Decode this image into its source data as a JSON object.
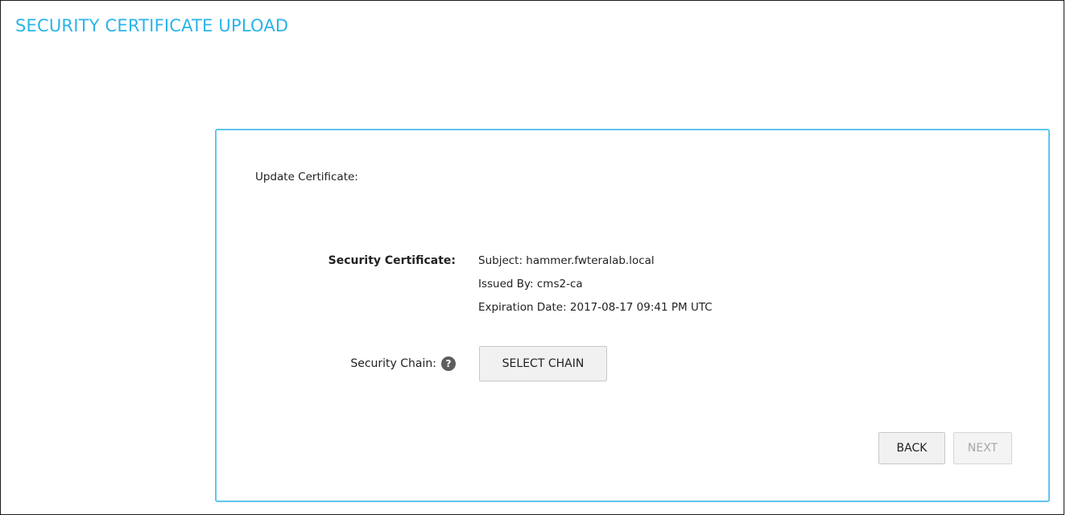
{
  "page": {
    "title": "SECURITY CERTIFICATE UPLOAD"
  },
  "panel": {
    "heading": "Update Certificate:",
    "certificate_label": "Security Certificate:",
    "certificate": {
      "subject": "Subject: hammer.fwteralab.local",
      "issued_by": "Issued By: cms2-ca",
      "expiration": "Expiration Date: 2017-08-17 09:41 PM UTC"
    },
    "chain_label": "Security Chain:",
    "chain_help_icon": "question-circle-icon",
    "select_chain_label": "SELECT CHAIN",
    "back_label": "BACK",
    "next_label": "NEXT",
    "next_enabled": false
  },
  "colors": {
    "title": "#29b4e8",
    "panel_border": "#5fc4ee",
    "help_icon_bg": "#5e5e5e",
    "disabled_text": "#a8a8a8"
  }
}
